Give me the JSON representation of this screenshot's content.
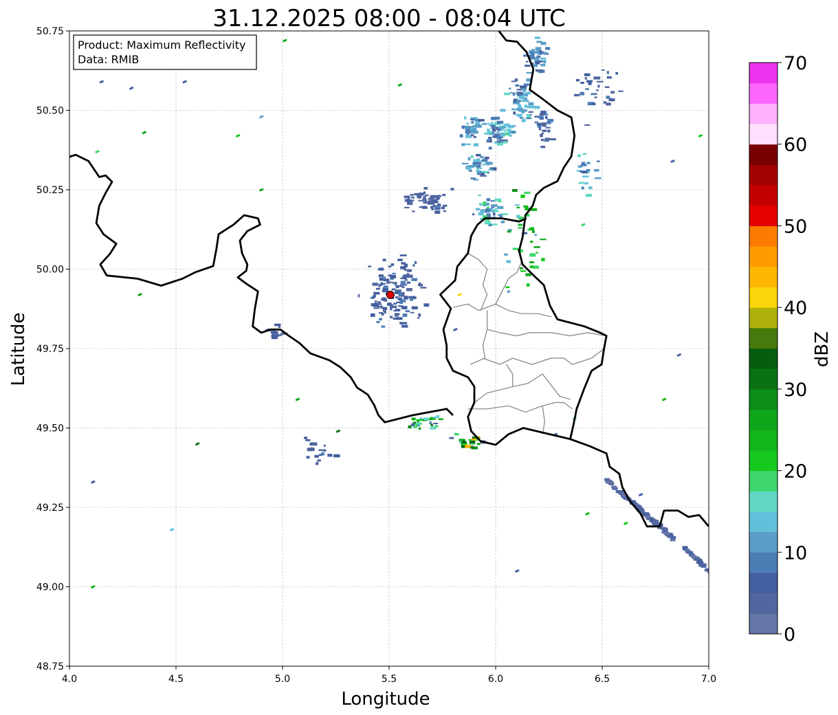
{
  "chart_data": {
    "type": "heatmap",
    "title": "31.12.2025 08:00 - 08:04 UTC",
    "xlabel": "Longitude",
    "ylabel": "Latitude",
    "xlim": [
      4.0,
      7.0
    ],
    "ylim": [
      48.75,
      50.75
    ],
    "xticks": [
      "4.0",
      "4.5",
      "5.0",
      "5.5",
      "6.0",
      "6.5",
      "7.0"
    ],
    "yticks": [
      "48.75",
      "49.00",
      "49.25",
      "49.50",
      "49.75",
      "50.00",
      "50.25",
      "50.50",
      "50.75"
    ],
    "grid": true,
    "info_box": {
      "line1": "Product: Maximum Reflectivity",
      "line2": "Data: RMIB",
      "placement": "top-left"
    },
    "radar_site": {
      "lon": 5.506,
      "lat": 49.919,
      "color": "#e00000"
    },
    "colorbar": {
      "label": "dBZ",
      "min": 0,
      "max": 70,
      "step": 2.5,
      "ticks": [
        "0",
        "10",
        "20",
        "30",
        "40",
        "50",
        "60",
        "70"
      ],
      "colors": [
        "#6576a8",
        "#52679f",
        "#445fa0",
        "#4c7db5",
        "#5a9ec8",
        "#63c0da",
        "#62d8c4",
        "#3dd66a",
        "#16c91f",
        "#12b51a",
        "#0ea61a",
        "#0b8d16",
        "#097314",
        "#055e10",
        "#467a0c",
        "#aeb10a",
        "#fcd60a",
        "#fdb700",
        "#fd9b00",
        "#fd7b00",
        "#e50000",
        "#c30000",
        "#a30000",
        "#780000",
        "#fee0fe",
        "#feb0fe",
        "#fd66fd",
        "#ee33ee"
      ]
    },
    "echo_clusters": [
      {
        "lon": 6.19,
        "lat": 50.67,
        "slon": 0.05,
        "slat": 0.05,
        "n": 40,
        "dbz": [
          3,
          14
        ]
      },
      {
        "lon": 6.11,
        "lat": 50.54,
        "slon": 0.05,
        "slat": 0.06,
        "n": 60,
        "dbz": [
          3,
          17
        ]
      },
      {
        "lon": 6.0,
        "lat": 50.44,
        "slon": 0.07,
        "slat": 0.05,
        "n": 70,
        "dbz": [
          3,
          18
        ]
      },
      {
        "lon": 5.87,
        "lat": 50.44,
        "slon": 0.04,
        "slat": 0.04,
        "n": 35,
        "dbz": [
          3,
          15
        ]
      },
      {
        "lon": 5.9,
        "lat": 50.33,
        "slon": 0.06,
        "slat": 0.04,
        "n": 40,
        "dbz": [
          3,
          16
        ]
      },
      {
        "lon": 5.96,
        "lat": 50.19,
        "slon": 0.06,
        "slat": 0.04,
        "n": 45,
        "dbz": [
          3,
          20
        ]
      },
      {
        "lon": 6.22,
        "lat": 50.46,
        "slon": 0.04,
        "slat": 0.05,
        "n": 30,
        "dbz": [
          3,
          10
        ]
      },
      {
        "lon": 5.51,
        "lat": 49.93,
        "slon": 0.12,
        "slat": 0.09,
        "n": 140,
        "dbz": [
          2,
          9
        ]
      },
      {
        "lon": 5.67,
        "lat": 50.22,
        "slon": 0.08,
        "slat": 0.03,
        "n": 50,
        "dbz": [
          2,
          8
        ]
      },
      {
        "lon": 6.12,
        "lat": 50.1,
        "slon": 0.08,
        "slat": 0.15,
        "n": 40,
        "dbz": [
          3,
          28
        ]
      },
      {
        "lon": 5.65,
        "lat": 49.52,
        "slon": 0.08,
        "slat": 0.02,
        "n": 30,
        "dbz": [
          3,
          32
        ]
      },
      {
        "lon": 5.87,
        "lat": 49.46,
        "slon": 0.06,
        "slat": 0.03,
        "n": 25,
        "dbz": [
          3,
          45
        ]
      },
      {
        "lon": 4.95,
        "lat": 49.8,
        "slon": 0.05,
        "slat": 0.02,
        "n": 15,
        "dbz": [
          3,
          8
        ]
      },
      {
        "lon": 5.15,
        "lat": 49.42,
        "slon": 0.08,
        "slat": 0.05,
        "n": 20,
        "dbz": [
          3,
          8
        ]
      },
      {
        "lon": 6.48,
        "lat": 50.55,
        "slon": 0.12,
        "slat": 0.08,
        "n": 30,
        "dbz": [
          3,
          10
        ]
      },
      {
        "lon": 6.4,
        "lat": 50.3,
        "slon": 0.06,
        "slat": 0.05,
        "n": 20,
        "dbz": [
          3,
          18
        ]
      }
    ],
    "echo_band": {
      "from": [
        6.51,
        49.34
      ],
      "to": [
        7.0,
        49.05
      ],
      "n": 120,
      "dbz": [
        2,
        6
      ]
    },
    "isolated_echoes": [
      [
        4.14,
        50.59,
        6
      ],
      [
        4.28,
        50.57,
        6
      ],
      [
        4.53,
        50.59,
        6
      ],
      [
        4.34,
        50.43,
        25
      ],
      [
        4.78,
        50.42,
        22
      ],
      [
        4.89,
        50.48,
        10
      ],
      [
        5.0,
        50.72,
        27
      ],
      [
        5.54,
        50.58,
        27
      ],
      [
        4.12,
        50.37,
        18
      ],
      [
        4.89,
        50.25,
        25
      ],
      [
        4.32,
        49.92,
        25
      ],
      [
        4.59,
        49.45,
        30
      ],
      [
        4.1,
        49.33,
        6
      ],
      [
        4.47,
        49.18,
        14
      ],
      [
        4.1,
        49.0,
        24
      ],
      [
        5.06,
        49.59,
        25
      ],
      [
        5.25,
        49.49,
        30
      ],
      [
        6.09,
        49.05,
        6
      ],
      [
        6.67,
        49.29,
        6
      ],
      [
        6.78,
        49.59,
        24
      ],
      [
        6.85,
        49.73,
        6
      ],
      [
        6.42,
        49.23,
        24
      ],
      [
        6.6,
        49.2,
        22
      ],
      [
        6.36,
        49.53,
        16
      ],
      [
        6.27,
        49.48,
        6
      ],
      [
        5.82,
        49.92,
        40
      ],
      [
        6.4,
        50.14,
        18
      ],
      [
        6.82,
        50.34,
        6
      ],
      [
        6.95,
        50.42,
        22
      ],
      [
        5.8,
        49.81,
        6
      ]
    ],
    "borders": [
      [
        [
          4.0,
          50.354
        ],
        [
          4.03,
          50.36
        ],
        [
          4.09,
          50.34
        ],
        [
          4.14,
          50.29
        ],
        [
          4.17,
          50.295
        ],
        [
          4.2,
          50.275
        ],
        [
          4.17,
          50.24
        ],
        [
          4.14,
          50.2
        ],
        [
          4.126,
          50.145
        ],
        [
          4.16,
          50.11
        ],
        [
          4.22,
          50.08
        ],
        [
          4.19,
          50.048
        ],
        [
          4.145,
          50.015
        ],
        [
          4.175,
          49.98
        ],
        [
          4.32,
          49.97
        ],
        [
          4.43,
          49.948
        ],
        [
          4.53,
          49.97
        ],
        [
          4.59,
          49.99
        ],
        [
          4.675,
          50.01
        ],
        [
          4.69,
          50.065
        ],
        [
          4.7,
          50.11
        ],
        [
          4.77,
          50.14
        ],
        [
          4.82,
          50.17
        ],
        [
          4.885,
          50.16
        ],
        [
          4.895,
          50.14
        ],
        [
          4.835,
          50.12
        ],
        [
          4.8,
          50.09
        ],
        [
          4.81,
          50.05
        ],
        [
          4.835,
          50.015
        ],
        [
          4.83,
          49.995
        ],
        [
          4.79,
          49.974
        ],
        [
          4.835,
          49.952
        ],
        [
          4.885,
          49.93
        ],
        [
          4.87,
          49.875
        ],
        [
          4.86,
          49.82
        ],
        [
          4.9,
          49.8
        ],
        [
          4.945,
          49.81
        ],
        [
          4.99,
          49.81
        ],
        [
          5.03,
          49.79
        ],
        [
          5.08,
          49.767
        ],
        [
          5.13,
          49.735
        ],
        [
          5.22,
          49.713
        ],
        [
          5.27,
          49.692
        ],
        [
          5.32,
          49.66
        ],
        [
          5.35,
          49.627
        ],
        [
          5.4,
          49.605
        ],
        [
          5.43,
          49.572
        ],
        [
          5.45,
          49.54
        ],
        [
          5.48,
          49.518
        ],
        [
          5.61,
          49.54
        ],
        [
          5.69,
          49.55
        ],
        [
          5.77,
          49.56
        ],
        [
          5.8,
          49.54
        ]
      ],
      [
        [
          6.015,
          50.75
        ],
        [
          6.05,
          50.72
        ],
        [
          6.1,
          50.716
        ],
        [
          6.145,
          50.684
        ],
        [
          6.177,
          50.63
        ],
        [
          6.16,
          50.565
        ],
        [
          6.226,
          50.533
        ],
        [
          6.29,
          50.5
        ],
        [
          6.355,
          50.478
        ],
        [
          6.37,
          50.42
        ],
        [
          6.355,
          50.355
        ],
        [
          6.32,
          50.32
        ],
        [
          6.29,
          50.277
        ],
        [
          6.226,
          50.256
        ],
        [
          6.19,
          50.234
        ],
        [
          6.174,
          50.2
        ],
        [
          6.14,
          50.17
        ],
        [
          6.126,
          50.1
        ],
        [
          6.11,
          50.058
        ],
        [
          6.126,
          50.015
        ],
        [
          6.174,
          49.983
        ],
        [
          6.226,
          49.95
        ],
        [
          6.255,
          49.885
        ],
        [
          6.29,
          49.842
        ],
        [
          6.416,
          49.82
        ],
        [
          6.49,
          49.8
        ],
        [
          6.52,
          49.79
        ],
        [
          6.51,
          49.755
        ],
        [
          6.497,
          49.7
        ],
        [
          6.45,
          49.68
        ],
        [
          6.416,
          49.625
        ],
        [
          6.38,
          49.56
        ],
        [
          6.365,
          49.51
        ],
        [
          6.35,
          49.465
        ],
        [
          6.13,
          49.5
        ],
        [
          6.06,
          49.48
        ],
        [
          6.0,
          49.447
        ],
        [
          5.93,
          49.458
        ],
        [
          5.885,
          49.49
        ],
        [
          5.87,
          49.535
        ],
        [
          5.9,
          49.58
        ],
        [
          5.9,
          49.63
        ],
        [
          5.87,
          49.66
        ],
        [
          5.8,
          49.68
        ],
        [
          5.77,
          49.72
        ],
        [
          5.77,
          49.76
        ],
        [
          5.755,
          49.81
        ],
        [
          5.79,
          49.876
        ],
        [
          5.74,
          49.92
        ],
        [
          5.81,
          49.965
        ],
        [
          5.82,
          50.008
        ],
        [
          5.87,
          50.05
        ],
        [
          5.885,
          50.105
        ],
        [
          5.915,
          50.14
        ],
        [
          5.95,
          50.16
        ],
        [
          6.03,
          50.16
        ],
        [
          6.11,
          50.15
        ],
        [
          6.145,
          50.16
        ]
      ],
      [
        [
          6.35,
          49.465
        ],
        [
          6.44,
          49.443
        ],
        [
          6.52,
          49.42
        ],
        [
          6.535,
          49.378
        ],
        [
          6.58,
          49.356
        ],
        [
          6.595,
          49.313
        ],
        [
          6.63,
          49.27
        ],
        [
          6.68,
          49.23
        ],
        [
          6.71,
          49.19
        ],
        [
          6.77,
          49.19
        ],
        [
          6.79,
          49.24
        ],
        [
          6.855,
          49.24
        ],
        [
          6.905,
          49.22
        ],
        [
          6.955,
          49.226
        ],
        [
          7.0,
          49.19
        ]
      ]
    ],
    "internal_lines": [
      [
        [
          5.8,
          49.88
        ],
        [
          5.87,
          49.89
        ],
        [
          5.92,
          49.87
        ],
        [
          6.0,
          49.89
        ],
        [
          6.06,
          49.87
        ],
        [
          6.12,
          49.86
        ],
        [
          6.2,
          49.86
        ],
        [
          6.26,
          49.85
        ]
      ],
      [
        [
          5.87,
          50.05
        ],
        [
          5.92,
          50.03
        ],
        [
          5.96,
          50.0
        ],
        [
          5.94,
          49.95
        ],
        [
          5.96,
          49.92
        ],
        [
          5.93,
          49.87
        ]
      ],
      [
        [
          6.0,
          49.89
        ],
        [
          6.03,
          49.93
        ],
        [
          6.06,
          49.97
        ],
        [
          6.1,
          49.99
        ],
        [
          6.12,
          50.02
        ]
      ],
      [
        [
          5.96,
          49.81
        ],
        [
          6.02,
          49.8
        ],
        [
          6.1,
          49.79
        ],
        [
          6.16,
          49.8
        ],
        [
          6.26,
          49.8
        ],
        [
          6.35,
          49.79
        ],
        [
          6.43,
          49.8
        ],
        [
          6.52,
          49.79
        ]
      ],
      [
        [
          5.96,
          49.87
        ],
        [
          5.96,
          49.81
        ],
        [
          5.94,
          49.76
        ],
        [
          5.95,
          49.72
        ],
        [
          5.88,
          49.7
        ]
      ],
      [
        [
          5.94,
          49.72
        ],
        [
          6.02,
          49.7
        ],
        [
          6.08,
          49.72
        ],
        [
          6.17,
          49.7
        ],
        [
          6.26,
          49.72
        ],
        [
          6.32,
          49.72
        ],
        [
          6.36,
          49.7
        ],
        [
          6.45,
          49.72
        ],
        [
          6.51,
          49.75
        ]
      ],
      [
        [
          5.9,
          49.58
        ],
        [
          5.96,
          49.61
        ],
        [
          6.02,
          49.62
        ],
        [
          6.08,
          49.63
        ],
        [
          6.08,
          49.67
        ],
        [
          6.05,
          49.7
        ]
      ],
      [
        [
          6.08,
          49.63
        ],
        [
          6.15,
          49.64
        ],
        [
          6.22,
          49.67
        ],
        [
          6.3,
          49.6
        ],
        [
          6.35,
          49.59
        ]
      ],
      [
        [
          5.87,
          49.56
        ],
        [
          5.96,
          49.56
        ],
        [
          6.06,
          49.57
        ],
        [
          6.14,
          49.55
        ],
        [
          6.22,
          49.57
        ],
        [
          6.23,
          49.52
        ],
        [
          6.22,
          49.48
        ]
      ],
      [
        [
          6.22,
          49.57
        ],
        [
          6.28,
          49.58
        ],
        [
          6.32,
          49.58
        ],
        [
          6.36,
          49.56
        ]
      ]
    ]
  }
}
